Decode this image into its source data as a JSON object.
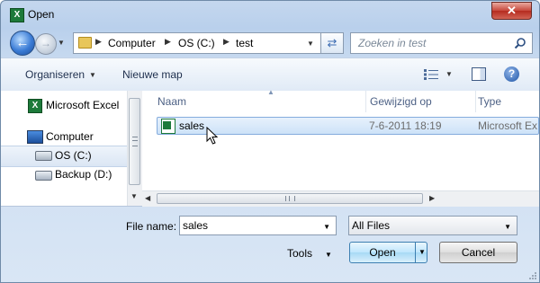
{
  "window": {
    "title": "Open",
    "title_icon": "excel-icon",
    "close_glyph": "✕"
  },
  "nav": {
    "back_glyph": "←",
    "forward_glyph": "→",
    "breadcrumb": [
      "Computer",
      "OS (C:)",
      "test"
    ],
    "search_placeholder": "Zoeken in test"
  },
  "toolbar": {
    "organise_label": "Organiseren",
    "new_folder_label": "Nieuwe map",
    "help_glyph": "?"
  },
  "sidebar": {
    "items": [
      {
        "label": "Microsoft Excel",
        "icon": "excel-icon"
      },
      {
        "label": "Computer",
        "icon": "computer-icon"
      },
      {
        "label": "OS (C:)",
        "icon": "drive-icon",
        "selected": true
      },
      {
        "label": "Backup (D:)",
        "icon": "drive-icon"
      }
    ]
  },
  "file_list": {
    "columns": [
      "Naam",
      "Gewijzigd op",
      "Type"
    ],
    "rows": [
      {
        "name": "sales",
        "modified": "7-6-2011 18:19",
        "type": "Microsoft Ex",
        "icon": "excel-file-icon",
        "selected": true
      }
    ]
  },
  "footer": {
    "file_name_label": "File name:",
    "file_name_value": "sales",
    "file_type_value": "All Files",
    "tools_label": "Tools",
    "open_label": "Open",
    "cancel_label": "Cancel"
  },
  "colors": {
    "accent": "#3c7fb1",
    "close": "#c7463a",
    "selection": "#cde2f8"
  }
}
